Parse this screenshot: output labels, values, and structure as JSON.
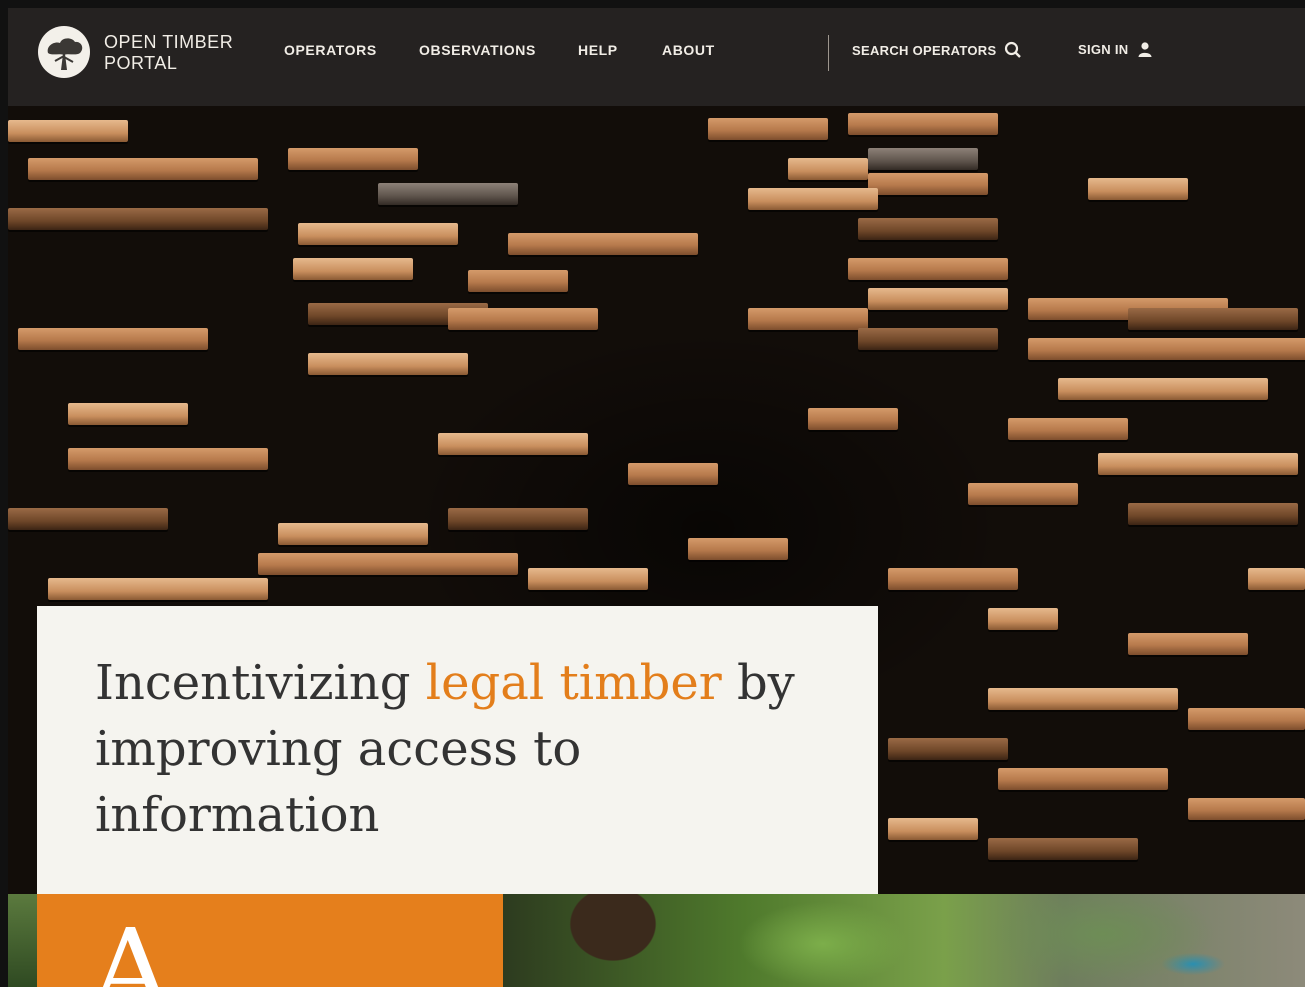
{
  "brand": {
    "name_line1": "OPEN TIMBER",
    "name_line2": "PORTAL"
  },
  "nav": {
    "items": [
      {
        "label": "OPERATORS"
      },
      {
        "label": "OBSERVATIONS"
      },
      {
        "label": "HELP"
      },
      {
        "label": "ABOUT"
      }
    ],
    "search_label": "SEARCH OPERATORS",
    "search_icon": "search-icon",
    "signin_label": "SIGN IN",
    "signin_icon": "user-icon"
  },
  "hero": {
    "headline_part1": "Incentivizing ",
    "headline_accent": "legal timber",
    "headline_part2": " by improving access to information",
    "accent_color": "#e37e1b"
  },
  "bottom": {
    "block_letter": "A",
    "block_color": "#e57f1c"
  }
}
